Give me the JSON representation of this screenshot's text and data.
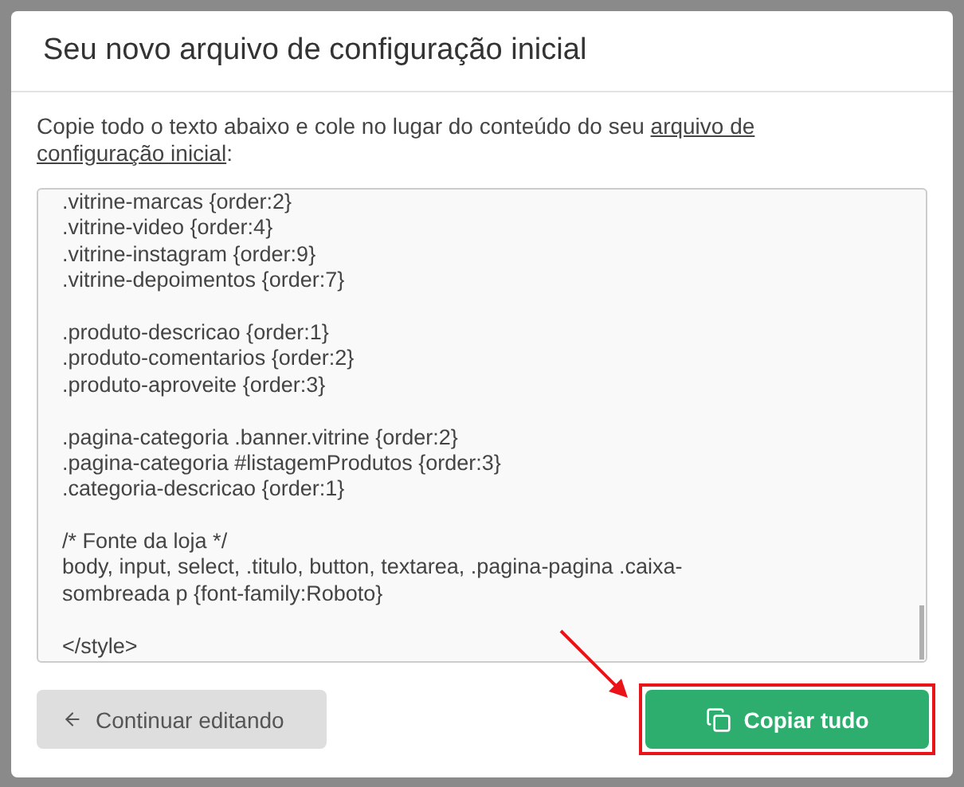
{
  "dialog": {
    "title": "Seu novo arquivo de configuração inicial"
  },
  "intro": {
    "text": "Copie todo o texto abaixo e cole no lugar do conteúdo do seu ",
    "link_parts": [
      "arquivo de",
      "configuração inicial"
    ],
    "after": ":"
  },
  "code_blocks": [
    [
      ".vitrine-marcas {order:2}",
      ".vitrine-video {order:4}",
      ".vitrine-instagram {order:9}",
      ".vitrine-depoimentos {order:7}"
    ],
    [
      ".produto-descricao {order:1}",
      ".produto-comentarios {order:2}",
      ".produto-aproveite {order:3}"
    ],
    [
      ".pagina-categoria .banner.vitrine {order:2}",
      ".pagina-categoria #listagemProdutos {order:3}",
      ".categoria-descricao {order:1}"
    ],
    [
      "/* Fonte da loja */",
      "body, input, select, .titulo, button, textarea, .pagina-pagina .caixa-",
      "sombreada p {font-family:Roboto}"
    ],
    [
      "</style>"
    ]
  ],
  "buttons": [
    {
      "kind": "secondary",
      "label": "Continuar editando"
    },
    {
      "kind": "primary",
      "label": "Copiar tudo"
    }
  ],
  "annotation": {
    "kind": "arrow_frame"
  }
}
